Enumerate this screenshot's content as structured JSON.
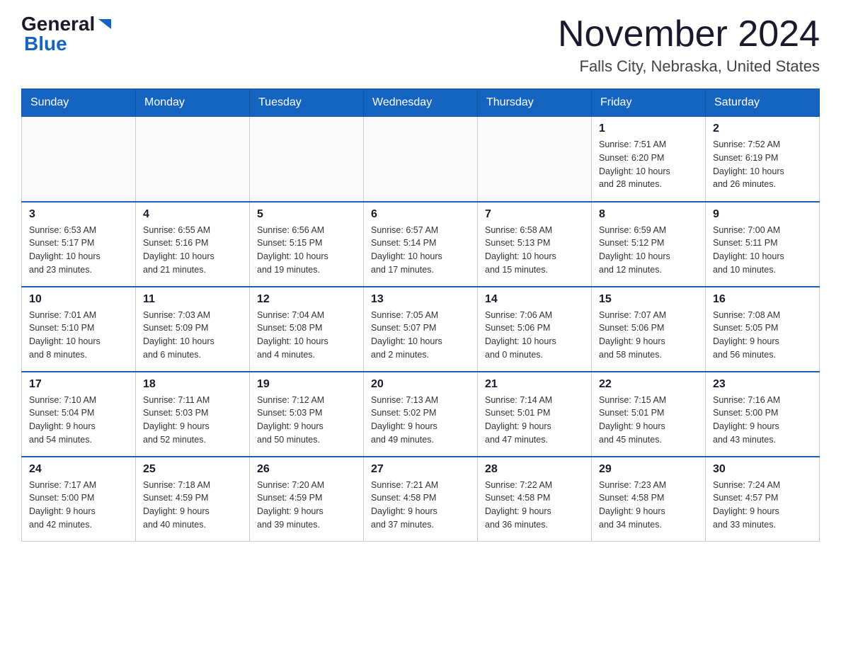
{
  "logo": {
    "general": "General",
    "blue": "Blue"
  },
  "title": "November 2024",
  "subtitle": "Falls City, Nebraska, United States",
  "weekdays": [
    "Sunday",
    "Monday",
    "Tuesday",
    "Wednesday",
    "Thursday",
    "Friday",
    "Saturday"
  ],
  "weeks": [
    [
      {
        "day": "",
        "info": ""
      },
      {
        "day": "",
        "info": ""
      },
      {
        "day": "",
        "info": ""
      },
      {
        "day": "",
        "info": ""
      },
      {
        "day": "",
        "info": ""
      },
      {
        "day": "1",
        "info": "Sunrise: 7:51 AM\nSunset: 6:20 PM\nDaylight: 10 hours\nand 28 minutes."
      },
      {
        "day": "2",
        "info": "Sunrise: 7:52 AM\nSunset: 6:19 PM\nDaylight: 10 hours\nand 26 minutes."
      }
    ],
    [
      {
        "day": "3",
        "info": "Sunrise: 6:53 AM\nSunset: 5:17 PM\nDaylight: 10 hours\nand 23 minutes."
      },
      {
        "day": "4",
        "info": "Sunrise: 6:55 AM\nSunset: 5:16 PM\nDaylight: 10 hours\nand 21 minutes."
      },
      {
        "day": "5",
        "info": "Sunrise: 6:56 AM\nSunset: 5:15 PM\nDaylight: 10 hours\nand 19 minutes."
      },
      {
        "day": "6",
        "info": "Sunrise: 6:57 AM\nSunset: 5:14 PM\nDaylight: 10 hours\nand 17 minutes."
      },
      {
        "day": "7",
        "info": "Sunrise: 6:58 AM\nSunset: 5:13 PM\nDaylight: 10 hours\nand 15 minutes."
      },
      {
        "day": "8",
        "info": "Sunrise: 6:59 AM\nSunset: 5:12 PM\nDaylight: 10 hours\nand 12 minutes."
      },
      {
        "day": "9",
        "info": "Sunrise: 7:00 AM\nSunset: 5:11 PM\nDaylight: 10 hours\nand 10 minutes."
      }
    ],
    [
      {
        "day": "10",
        "info": "Sunrise: 7:01 AM\nSunset: 5:10 PM\nDaylight: 10 hours\nand 8 minutes."
      },
      {
        "day": "11",
        "info": "Sunrise: 7:03 AM\nSunset: 5:09 PM\nDaylight: 10 hours\nand 6 minutes."
      },
      {
        "day": "12",
        "info": "Sunrise: 7:04 AM\nSunset: 5:08 PM\nDaylight: 10 hours\nand 4 minutes."
      },
      {
        "day": "13",
        "info": "Sunrise: 7:05 AM\nSunset: 5:07 PM\nDaylight: 10 hours\nand 2 minutes."
      },
      {
        "day": "14",
        "info": "Sunrise: 7:06 AM\nSunset: 5:06 PM\nDaylight: 10 hours\nand 0 minutes."
      },
      {
        "day": "15",
        "info": "Sunrise: 7:07 AM\nSunset: 5:06 PM\nDaylight: 9 hours\nand 58 minutes."
      },
      {
        "day": "16",
        "info": "Sunrise: 7:08 AM\nSunset: 5:05 PM\nDaylight: 9 hours\nand 56 minutes."
      }
    ],
    [
      {
        "day": "17",
        "info": "Sunrise: 7:10 AM\nSunset: 5:04 PM\nDaylight: 9 hours\nand 54 minutes."
      },
      {
        "day": "18",
        "info": "Sunrise: 7:11 AM\nSunset: 5:03 PM\nDaylight: 9 hours\nand 52 minutes."
      },
      {
        "day": "19",
        "info": "Sunrise: 7:12 AM\nSunset: 5:03 PM\nDaylight: 9 hours\nand 50 minutes."
      },
      {
        "day": "20",
        "info": "Sunrise: 7:13 AM\nSunset: 5:02 PM\nDaylight: 9 hours\nand 49 minutes."
      },
      {
        "day": "21",
        "info": "Sunrise: 7:14 AM\nSunset: 5:01 PM\nDaylight: 9 hours\nand 47 minutes."
      },
      {
        "day": "22",
        "info": "Sunrise: 7:15 AM\nSunset: 5:01 PM\nDaylight: 9 hours\nand 45 minutes."
      },
      {
        "day": "23",
        "info": "Sunrise: 7:16 AM\nSunset: 5:00 PM\nDaylight: 9 hours\nand 43 minutes."
      }
    ],
    [
      {
        "day": "24",
        "info": "Sunrise: 7:17 AM\nSunset: 5:00 PM\nDaylight: 9 hours\nand 42 minutes."
      },
      {
        "day": "25",
        "info": "Sunrise: 7:18 AM\nSunset: 4:59 PM\nDaylight: 9 hours\nand 40 minutes."
      },
      {
        "day": "26",
        "info": "Sunrise: 7:20 AM\nSunset: 4:59 PM\nDaylight: 9 hours\nand 39 minutes."
      },
      {
        "day": "27",
        "info": "Sunrise: 7:21 AM\nSunset: 4:58 PM\nDaylight: 9 hours\nand 37 minutes."
      },
      {
        "day": "28",
        "info": "Sunrise: 7:22 AM\nSunset: 4:58 PM\nDaylight: 9 hours\nand 36 minutes."
      },
      {
        "day": "29",
        "info": "Sunrise: 7:23 AM\nSunset: 4:58 PM\nDaylight: 9 hours\nand 34 minutes."
      },
      {
        "day": "30",
        "info": "Sunrise: 7:24 AM\nSunset: 4:57 PM\nDaylight: 9 hours\nand 33 minutes."
      }
    ]
  ]
}
